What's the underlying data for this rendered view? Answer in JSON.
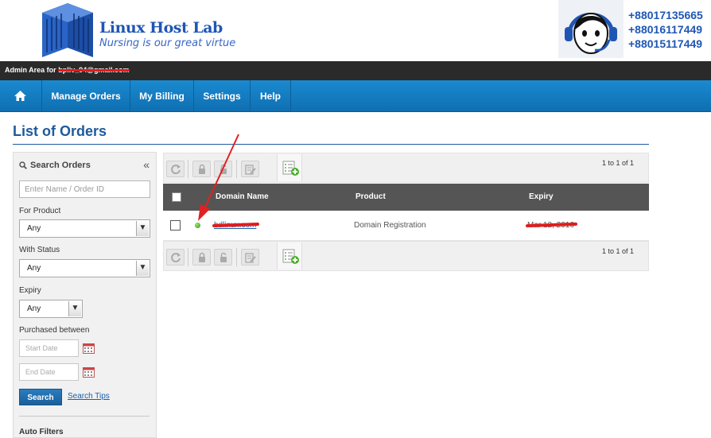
{
  "brand": {
    "title": "Linux Host Lab",
    "tagline": "Nursing is our great virtue",
    "phones": [
      "+88017135665",
      "+88016117449",
      "+88015117449"
    ]
  },
  "admin_bar": {
    "prefix": "Admin Area for",
    "email": "bpliv_94@gmail.com"
  },
  "nav": {
    "items": [
      {
        "label": "Manage Orders"
      },
      {
        "label": "My Billing"
      },
      {
        "label": "Settings"
      },
      {
        "label": "Help"
      }
    ]
  },
  "page": {
    "title": "List of Orders"
  },
  "sidebar": {
    "heading": "Search Orders",
    "collapse_glyph": "«",
    "search_placeholder": "Enter Name / Order ID",
    "for_product_label": "For Product",
    "for_product_value": "Any",
    "with_status_label": "With Status",
    "with_status_value": "Any",
    "expiry_label": "Expiry",
    "expiry_value": "Any",
    "purchased_label": "Purchased between",
    "start_placeholder": "Start Date",
    "end_placeholder": "End Date",
    "search_button": "Search",
    "search_tips": "Search Tips",
    "auto_filters": "Auto Filters"
  },
  "toolbar": {
    "pager_text": "1 to 1 of 1"
  },
  "table": {
    "columns": [
      "Domain Name",
      "Product",
      "Expiry"
    ],
    "rows": [
      {
        "domain": "bdlinux.com",
        "product": "Domain Registration",
        "expiry": "Mar 12, 2016"
      }
    ]
  },
  "colors": {
    "brand_blue": "#1f56b4",
    "nav_blue": "#1a8ad0",
    "title_blue": "#1d5a9c",
    "status_active": "#2f9a1a",
    "redaction_red": "#e31b1b"
  }
}
